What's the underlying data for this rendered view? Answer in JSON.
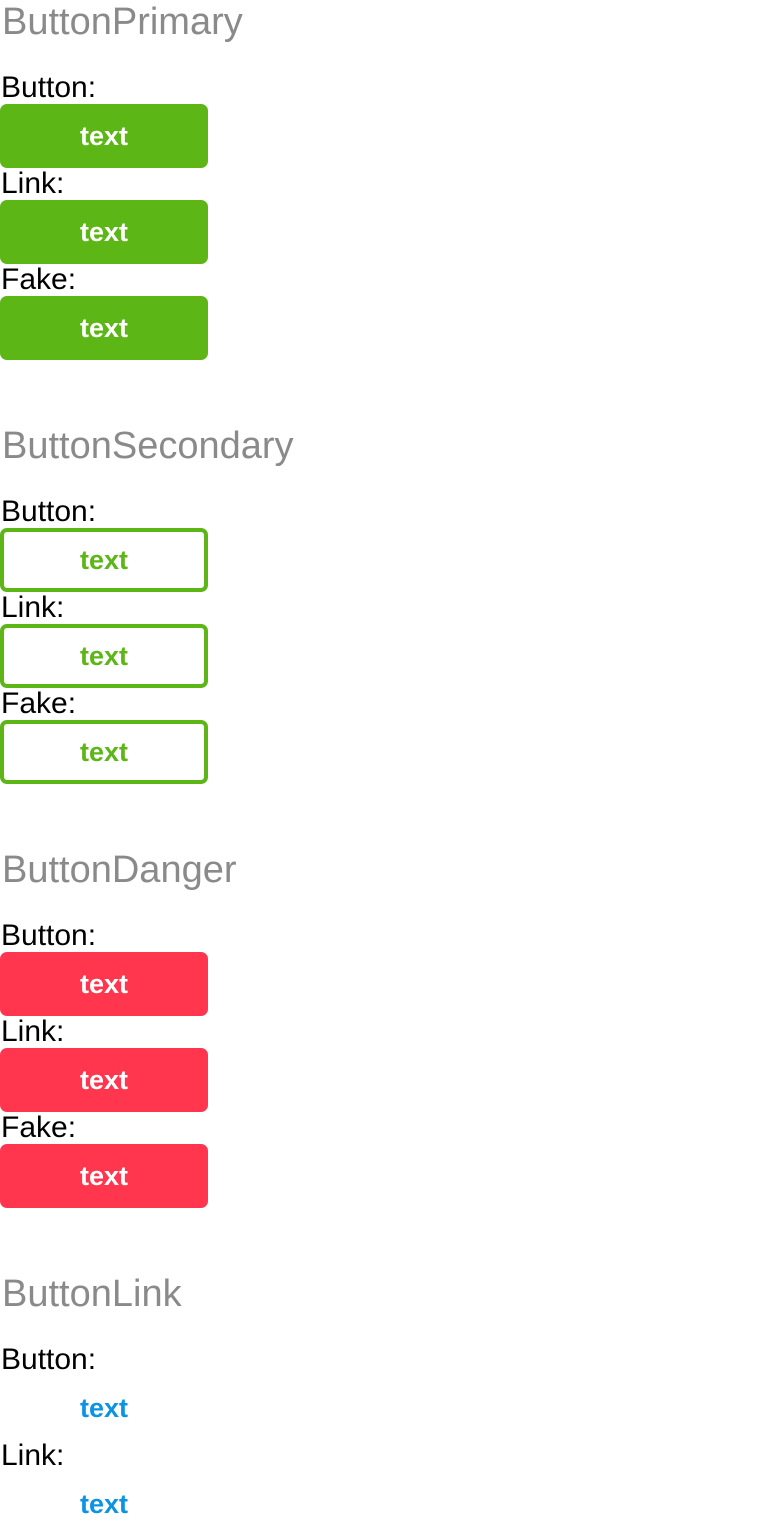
{
  "colors": {
    "primary": "#5cb615",
    "danger": "#ff364d",
    "link": "#0c93e4",
    "title": "#8a8a8a"
  },
  "sections": [
    {
      "title": "ButtonPrimary",
      "rows": [
        {
          "label": "Button:",
          "button_text": "text"
        },
        {
          "label": "Link:",
          "button_text": "text"
        },
        {
          "label": "Fake:",
          "button_text": "text"
        }
      ]
    },
    {
      "title": "ButtonSecondary",
      "rows": [
        {
          "label": "Button:",
          "button_text": "text"
        },
        {
          "label": "Link:",
          "button_text": "text"
        },
        {
          "label": "Fake:",
          "button_text": "text"
        }
      ]
    },
    {
      "title": "ButtonDanger",
      "rows": [
        {
          "label": "Button:",
          "button_text": "text"
        },
        {
          "label": "Link:",
          "button_text": "text"
        },
        {
          "label": "Fake:",
          "button_text": "text"
        }
      ]
    },
    {
      "title": "ButtonLink",
      "rows": [
        {
          "label": "Button:",
          "button_text": "text"
        },
        {
          "label": "Link:",
          "button_text": "text"
        }
      ]
    }
  ]
}
